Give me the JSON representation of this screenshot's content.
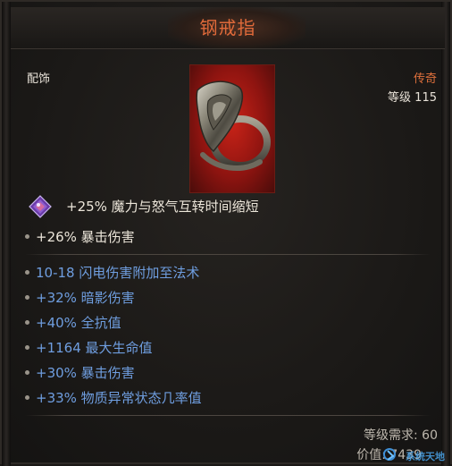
{
  "item": {
    "name": "钢戒指",
    "type": "配饰",
    "rarity": "传奇",
    "level": "等级 115"
  },
  "implicit": {
    "icon": "purple-gem-icon",
    "text": "+25% 魔力与怒气互转时间缩短"
  },
  "base_stats": [
    "+26% 暴击伤害"
  ],
  "affixes": [
    "10-18 闪电伤害附加至法术",
    "+32% 暗影伤害",
    "+40% 全抗值",
    "+1164 最大生命值",
    "+30% 暴击伤害",
    "+33% 物质异常状态几率值"
  ],
  "requirement": "等级需求: 60",
  "price": "价值: 7439",
  "watermark": "系统天地",
  "colors": {
    "title": "#e06a3a",
    "rarity": "#e0703c",
    "affix": "#6f9ee0",
    "text": "#ece6da"
  }
}
